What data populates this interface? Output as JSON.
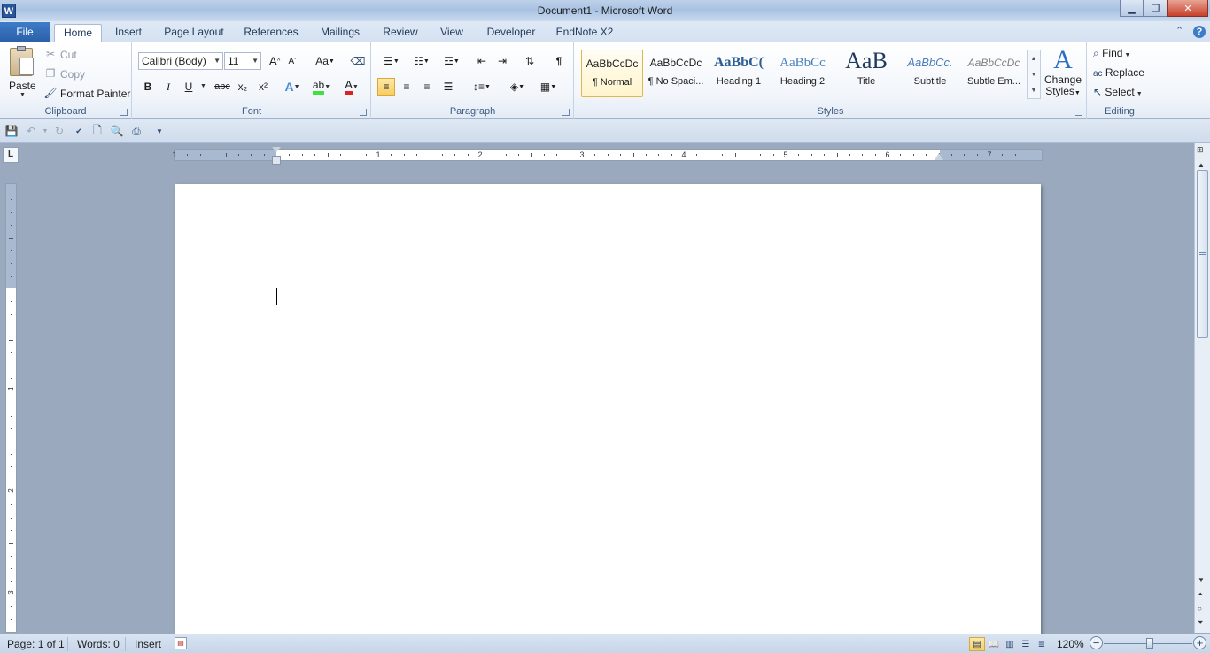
{
  "window": {
    "title": "Document1 - Microsoft Word",
    "app_icon_letter": "W"
  },
  "tabs": [
    "File",
    "Home",
    "Insert",
    "Page Layout",
    "References",
    "Mailings",
    "Review",
    "View",
    "Developer",
    "EndNote X2"
  ],
  "active_tab": "Home",
  "clipboard": {
    "paste": "Paste",
    "cut": "Cut",
    "copy": "Copy",
    "format_painter": "Format Painter",
    "group_label": "Clipboard"
  },
  "font": {
    "family": "Calibri (Body)",
    "size": "11",
    "group_label": "Font",
    "bold": "B",
    "italic": "I",
    "underline": "U",
    "strike": "abc",
    "subscript": "x₂",
    "superscript": "x²",
    "change_case": "Aa",
    "grow": "A",
    "shrink": "A",
    "color_accent": "#e02020",
    "highlight_accent": "#40e040"
  },
  "paragraph": {
    "group_label": "Paragraph",
    "pilcrow": "¶"
  },
  "styles": {
    "group_label": "Styles",
    "items": [
      {
        "sample": "AaBbCcDc",
        "name": "¶ Normal"
      },
      {
        "sample": "AaBbCcDc",
        "name": "¶ No Spaci..."
      },
      {
        "sample": "AaBbC(",
        "name": "Heading 1"
      },
      {
        "sample": "AaBbCc",
        "name": "Heading 2"
      },
      {
        "sample": "AaB",
        "name": "Title"
      },
      {
        "sample": "AaBbCc.",
        "name": "Subtitle"
      },
      {
        "sample": "AaBbCcDc",
        "name": "Subtle Em..."
      }
    ],
    "change_styles_line1": "Change",
    "change_styles_line2": "Styles"
  },
  "editing": {
    "group_label": "Editing",
    "find": "Find",
    "replace": "Replace",
    "select": "Select"
  },
  "ruler": {
    "h_numbers": [
      "1",
      "1",
      "2",
      "3",
      "4",
      "5",
      "6",
      "7"
    ],
    "v_numbers": [
      "1",
      "2",
      "3"
    ],
    "tab_selector": "L"
  },
  "status": {
    "page": "Page: 1 of 1",
    "words": "Words: 0",
    "mode": "Insert",
    "zoom": "120%"
  },
  "accent_color": "#2b579a"
}
